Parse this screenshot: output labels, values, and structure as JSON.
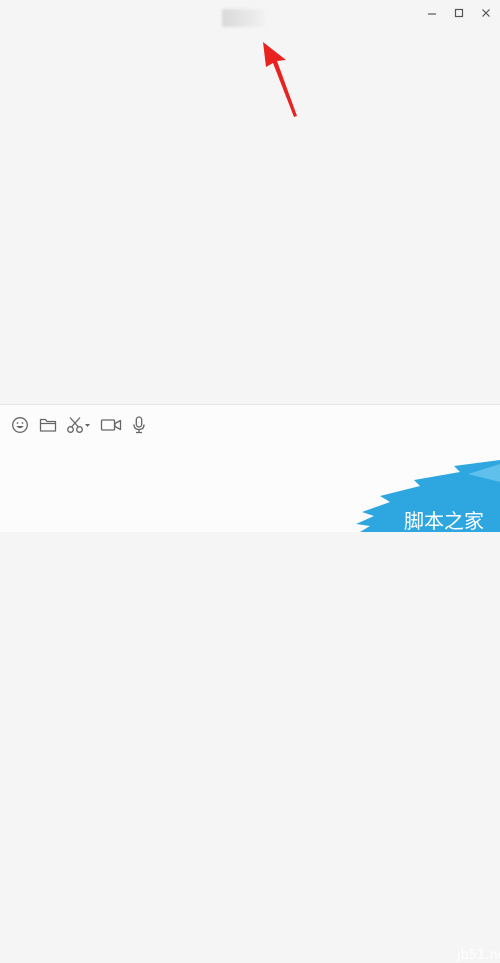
{
  "window": {
    "title": "",
    "controls": {
      "minimize": "minimize-icon",
      "maximize": "maximize-icon",
      "close": "close-icon"
    }
  },
  "annotation": {
    "arrow_color": "#e8231f"
  },
  "toolbar": {
    "items": [
      {
        "icon": "emoji-icon"
      },
      {
        "icon": "folder-icon"
      },
      {
        "icon": "scissors-icon"
      },
      {
        "icon": "video-icon"
      },
      {
        "icon": "microphone-icon"
      }
    ]
  },
  "input": {
    "value": ""
  },
  "watermark": {
    "domain": "jb51.net",
    "text": "脚本之家",
    "color": "#2ea7e0"
  }
}
